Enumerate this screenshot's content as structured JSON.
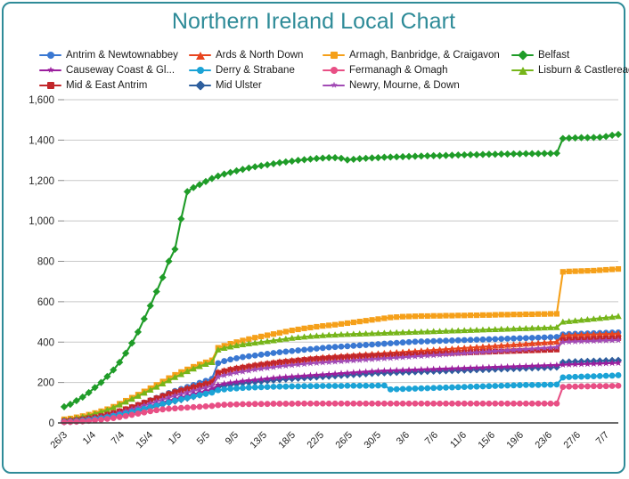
{
  "chart_title": "Northern Ireland Local Chart",
  "theme": {
    "border_color": "#2e8b98",
    "title_color": "#2e8b98",
    "grid_color": "#c8c8c8",
    "axis_color": "#3a3a3a",
    "background": "#ffffff"
  },
  "legend": {
    "position": "top",
    "items": [
      {
        "label": "Antrim & Newtownabbey",
        "color": "#3a78d2",
        "marker": "circle"
      },
      {
        "label": "Ards & North Down",
        "color": "#e8451f",
        "marker": "triangle"
      },
      {
        "label": "Armagh, Banbridge, & Craigavon",
        "color": "#f5a01a",
        "marker": "square"
      },
      {
        "label": "Belfast",
        "color": "#1f9c28",
        "marker": "diamond"
      },
      {
        "label": "Causeway Coast & Gl...",
        "color": "#9b1f9e",
        "marker": "star"
      },
      {
        "label": "Derry & Strabane",
        "color": "#1ba3d6",
        "marker": "circle"
      },
      {
        "label": "Fermanagh & Omagh",
        "color": "#e84f85",
        "marker": "circle"
      },
      {
        "label": "Lisburn & Castlereagh",
        "color": "#76b51a",
        "marker": "triangle"
      },
      {
        "label": "Mid & East Antrim",
        "color": "#c2262a",
        "marker": "square"
      },
      {
        "label": "Mid Ulster",
        "color": "#2e5f9e",
        "marker": "diamond"
      },
      {
        "label": "Newry, Mourne, & Down",
        "color": "#a24bb5",
        "marker": "star"
      }
    ]
  },
  "chart_data": {
    "type": "line",
    "title": "Northern Ireland Local Chart",
    "xlabel": "",
    "ylabel": "",
    "ylim": [
      0,
      1600
    ],
    "ytick_step": 200,
    "ytick_labels": [
      "0",
      "200",
      "400",
      "600",
      "800",
      "1,000",
      "1,200",
      "1,400",
      "1,600"
    ],
    "grid": true,
    "legend_position": "top",
    "x_tick_labels": [
      "26/3",
      "1/4",
      "7/4",
      "15/4",
      "1/5",
      "5/5",
      "9/5",
      "13/5",
      "18/5",
      "22/5",
      "26/5",
      "30/5",
      "3/6",
      "7/6",
      "11/6",
      "15/6",
      "19/6",
      "23/6",
      "27/6",
      "7/7"
    ],
    "x": [
      "26/3",
      "27/3",
      "28/3",
      "29/3",
      "30/3",
      "31/3",
      "1/4",
      "2/4",
      "3/4",
      "4/4",
      "5/4",
      "6/4",
      "7/4",
      "8/4",
      "9/4",
      "10/4",
      "11/4",
      "12/4",
      "13/4",
      "14/4",
      "15/4",
      "16/4",
      "17/4",
      "18/4",
      "19/4",
      "1/5",
      "2/5",
      "3/5",
      "4/5",
      "5/5",
      "6/5",
      "7/5",
      "8/5",
      "9/5",
      "10/5",
      "11/5",
      "12/5",
      "13/5",
      "14/5",
      "15/5",
      "16/5",
      "18/5",
      "19/5",
      "20/5",
      "21/5",
      "22/5",
      "23/5",
      "24/5",
      "25/5",
      "26/5",
      "27/5",
      "28/5",
      "29/5",
      "30/5",
      "31/5",
      "1/6",
      "2/6",
      "3/6",
      "4/6",
      "5/6",
      "6/6",
      "7/6",
      "8/6",
      "9/6",
      "10/6",
      "11/6",
      "12/6",
      "13/6",
      "14/6",
      "15/6",
      "16/6",
      "17/6",
      "18/6",
      "19/6",
      "20/6",
      "21/6",
      "22/6",
      "23/6",
      "24/6",
      "25/6",
      "26/6",
      "27/6",
      "28/6",
      "29/6",
      "30/6",
      "1/7",
      "2/7",
      "3/7",
      "4/7",
      "5/7",
      "7/7"
    ],
    "series": [
      {
        "name": "Belfast",
        "color": "#1f9c28",
        "marker": "diamond",
        "values": [
          80,
          92,
          110,
          128,
          150,
          175,
          200,
          230,
          262,
          300,
          345,
          395,
          450,
          515,
          580,
          650,
          720,
          800,
          860,
          1010,
          1145,
          1165,
          1180,
          1195,
          1210,
          1222,
          1232,
          1240,
          1248,
          1255,
          1262,
          1268,
          1273,
          1278,
          1283,
          1288,
          1292,
          1296,
          1300,
          1303,
          1306,
          1309,
          1311,
          1313,
          1313,
          1310,
          1302,
          1305,
          1308,
          1310,
          1312,
          1313,
          1315,
          1316,
          1317,
          1318,
          1319,
          1320,
          1321,
          1322,
          1323,
          1323,
          1324,
          1325,
          1326,
          1327,
          1328,
          1328,
          1329,
          1330,
          1330,
          1331,
          1331,
          1332,
          1332,
          1333,
          1333,
          1333,
          1334,
          1334,
          1335,
          1408,
          1410,
          1411,
          1412,
          1412,
          1413,
          1414,
          1418,
          1424,
          1428
        ]
      },
      {
        "name": "Armagh, Banbridge, & Craigavon",
        "color": "#f5a01a",
        "marker": "square",
        "values": [
          18,
          22,
          28,
          34,
          41,
          49,
          58,
          68,
          80,
          95,
          110,
          125,
          140,
          156,
          172,
          188,
          205,
          222,
          238,
          252,
          265,
          278,
          290,
          300,
          310,
          372,
          382,
          392,
          400,
          408,
          415,
          422,
          428,
          434,
          440,
          446,
          452,
          458,
          463,
          468,
          472,
          476,
          480,
          483,
          486,
          490,
          494,
          498,
          502,
          506,
          510,
          514,
          518,
          522,
          524,
          526,
          527,
          528,
          529,
          529,
          530,
          530,
          531,
          531,
          532,
          532,
          533,
          533,
          534,
          534,
          535,
          536,
          536,
          537,
          537,
          538,
          538,
          539,
          539,
          540,
          540,
          748,
          750,
          751,
          752,
          753,
          754,
          756,
          758,
          760,
          762
        ]
      },
      {
        "name": "Lisburn & Castlereagh",
        "color": "#76b51a",
        "marker": "triangle",
        "values": [
          15,
          19,
          24,
          30,
          37,
          45,
          54,
          64,
          76,
          90,
          104,
          118,
          133,
          148,
          163,
          178,
          194,
          210,
          226,
          240,
          255,
          268,
          280,
          291,
          300,
          362,
          370,
          377,
          383,
          388,
          392,
          396,
          400,
          404,
          408,
          412,
          416,
          420,
          423,
          426,
          429,
          431,
          433,
          435,
          436,
          438,
          439,
          440,
          441,
          442,
          443,
          444,
          445,
          446,
          447,
          448,
          449,
          450,
          451,
          452,
          453,
          454,
          455,
          456,
          457,
          458,
          459,
          460,
          461,
          462,
          463,
          464,
          465,
          466,
          467,
          468,
          469,
          470,
          471,
          472,
          473,
          500,
          503,
          506,
          509,
          512,
          515,
          518,
          521,
          524,
          528
        ]
      },
      {
        "name": "Antrim & Newtownabbey",
        "color": "#3a78d2",
        "marker": "circle",
        "values": [
          8,
          10,
          13,
          17,
          21,
          26,
          32,
          39,
          47,
          56,
          66,
          77,
          88,
          100,
          112,
          124,
          136,
          148,
          158,
          168,
          178,
          188,
          198,
          208,
          218,
          296,
          306,
          314,
          320,
          326,
          330,
          334,
          338,
          342,
          346,
          350,
          353,
          356,
          359,
          362,
          365,
          368,
          371,
          374,
          376,
          378,
          380,
          382,
          384,
          386,
          388,
          390,
          392,
          394,
          396,
          398,
          400,
          402,
          403,
          404,
          405,
          406,
          407,
          408,
          409,
          410,
          411,
          412,
          413,
          414,
          415,
          416,
          417,
          418,
          419,
          420,
          421,
          422,
          423,
          424,
          425,
          438,
          440,
          441,
          442,
          443,
          444,
          445,
          446,
          447,
          448
        ]
      },
      {
        "name": "Ards & North Down",
        "color": "#e8451f",
        "marker": "triangle",
        "values": [
          10,
          12,
          15,
          19,
          24,
          29,
          35,
          42,
          50,
          59,
          69,
          79,
          90,
          101,
          112,
          123,
          134,
          145,
          155,
          164,
          173,
          182,
          190,
          198,
          206,
          252,
          260,
          267,
          273,
          278,
          283,
          288,
          292,
          296,
          300,
          304,
          307,
          310,
          313,
          316,
          319,
          322,
          325,
          327,
          329,
          331,
          333,
          335,
          337,
          339,
          341,
          343,
          345,
          347,
          349,
          351,
          353,
          355,
          357,
          359,
          361,
          363,
          365,
          367,
          369,
          371,
          373,
          375,
          377,
          379,
          381,
          383,
          385,
          387,
          389,
          391,
          393,
          395,
          397,
          399,
          401,
          432,
          434,
          435,
          436,
          437,
          438,
          439,
          440,
          441,
          442
        ]
      },
      {
        "name": "Mid & East Antrim",
        "color": "#c2262a",
        "marker": "square",
        "values": [
          9,
          11,
          14,
          18,
          23,
          28,
          34,
          41,
          49,
          58,
          68,
          78,
          89,
          100,
          111,
          122,
          133,
          143,
          152,
          160,
          168,
          176,
          184,
          192,
          200,
          248,
          256,
          263,
          269,
          274,
          279,
          284,
          288,
          292,
          296,
          300,
          303,
          306,
          309,
          312,
          315,
          317,
          319,
          321,
          323,
          325,
          327,
          329,
          331,
          332,
          333,
          334,
          335,
          336,
          337,
          338,
          339,
          340,
          341,
          342,
          343,
          344,
          345,
          346,
          347,
          348,
          349,
          350,
          351,
          352,
          353,
          354,
          355,
          356,
          357,
          358,
          359,
          360,
          361,
          362,
          363,
          410,
          412,
          413,
          414,
          415,
          416,
          417,
          418,
          419,
          420
        ]
      },
      {
        "name": "Newry, Mourne, & Down",
        "color": "#a24bb5",
        "marker": "star",
        "values": [
          7,
          9,
          12,
          15,
          19,
          24,
          29,
          35,
          42,
          50,
          58,
          67,
          76,
          86,
          96,
          106,
          116,
          126,
          135,
          143,
          151,
          159,
          167,
          175,
          183,
          228,
          236,
          243,
          249,
          254,
          259,
          264,
          268,
          272,
          276,
          280,
          283,
          286,
          289,
          292,
          295,
          297,
          299,
          301,
          303,
          305,
          307,
          309,
          311,
          313,
          315,
          317,
          319,
          321,
          323,
          325,
          327,
          329,
          331,
          333,
          335,
          337,
          339,
          341,
          343,
          345,
          347,
          349,
          351,
          353,
          355,
          357,
          359,
          361,
          363,
          365,
          367,
          369,
          371,
          373,
          375,
          400,
          402,
          403,
          404,
          405,
          406,
          407,
          408,
          409,
          410
        ]
      },
      {
        "name": "Mid Ulster",
        "color": "#2e5f9e",
        "marker": "diamond",
        "values": [
          5,
          6,
          8,
          10,
          13,
          17,
          21,
          26,
          31,
          37,
          44,
          51,
          59,
          67,
          75,
          83,
          92,
          100,
          108,
          115,
          122,
          130,
          138,
          146,
          154,
          178,
          184,
          189,
          193,
          197,
          200,
          203,
          206,
          209,
          212,
          215,
          217,
          219,
          221,
          223,
          225,
          227,
          229,
          231,
          233,
          235,
          237,
          239,
          241,
          243,
          245,
          247,
          248,
          249,
          250,
          251,
          252,
          253,
          254,
          255,
          256,
          257,
          258,
          259,
          260,
          261,
          262,
          263,
          264,
          265,
          266,
          267,
          268,
          269,
          270,
          271,
          272,
          273,
          274,
          275,
          276,
          300,
          302,
          303,
          304,
          305,
          306,
          307,
          308,
          309,
          310
        ]
      },
      {
        "name": "Causeway Coast & Gl...",
        "color": "#9b1f9e",
        "marker": "star",
        "values": [
          6,
          8,
          10,
          13,
          16,
          20,
          25,
          30,
          36,
          43,
          50,
          58,
          66,
          74,
          83,
          92,
          101,
          110,
          118,
          126,
          134,
          142,
          150,
          158,
          166,
          188,
          194,
          199,
          203,
          207,
          210,
          213,
          216,
          219,
          222,
          225,
          227,
          229,
          231,
          233,
          235,
          237,
          239,
          241,
          243,
          245,
          247,
          249,
          251,
          253,
          255,
          257,
          258,
          259,
          260,
          261,
          262,
          263,
          264,
          265,
          266,
          267,
          268,
          269,
          270,
          271,
          272,
          273,
          274,
          275,
          276,
          277,
          278,
          279,
          280,
          281,
          282,
          283,
          284,
          285,
          286,
          288,
          289,
          290,
          291,
          292,
          293,
          294,
          295,
          296,
          297
        ]
      },
      {
        "name": "Derry & Strabane",
        "color": "#1ba3d6",
        "marker": "circle",
        "values": [
          6,
          7,
          9,
          12,
          15,
          19,
          23,
          28,
          34,
          40,
          47,
          54,
          62,
          70,
          78,
          86,
          94,
          102,
          110,
          117,
          124,
          131,
          138,
          144,
          150,
          162,
          166,
          169,
          171,
          173,
          175,
          176,
          177,
          178,
          179,
          180,
          180,
          181,
          181,
          182,
          182,
          182,
          183,
          183,
          183,
          183,
          184,
          184,
          184,
          184,
          184,
          185,
          185,
          166,
          167,
          168,
          169,
          170,
          171,
          172,
          173,
          174,
          175,
          176,
          177,
          178,
          179,
          180,
          181,
          182,
          183,
          184,
          185,
          186,
          187,
          188,
          188,
          188,
          189,
          189,
          190,
          225,
          227,
          228,
          229,
          230,
          231,
          232,
          233,
          234,
          236
        ]
      },
      {
        "name": "Fermanagh & Omagh",
        "color": "#e84f85",
        "marker": "circle",
        "values": [
          4,
          5,
          6,
          8,
          10,
          13,
          16,
          20,
          24,
          29,
          34,
          40,
          46,
          52,
          58,
          63,
          67,
          70,
          72,
          74,
          76,
          78,
          80,
          82,
          84,
          88,
          90,
          91,
          92,
          93,
          93,
          94,
          94,
          94,
          95,
          95,
          95,
          95,
          96,
          96,
          96,
          96,
          96,
          96,
          96,
          96,
          96,
          96,
          96,
          96,
          96,
          96,
          96,
          96,
          96,
          96,
          96,
          96,
          96,
          96,
          96,
          96,
          96,
          96,
          96,
          96,
          96,
          96,
          96,
          96,
          96,
          96,
          96,
          96,
          96,
          96,
          96,
          96,
          96,
          96,
          96,
          178,
          180,
          180,
          181,
          181,
          182,
          182,
          182,
          183,
          184
        ]
      }
    ]
  }
}
